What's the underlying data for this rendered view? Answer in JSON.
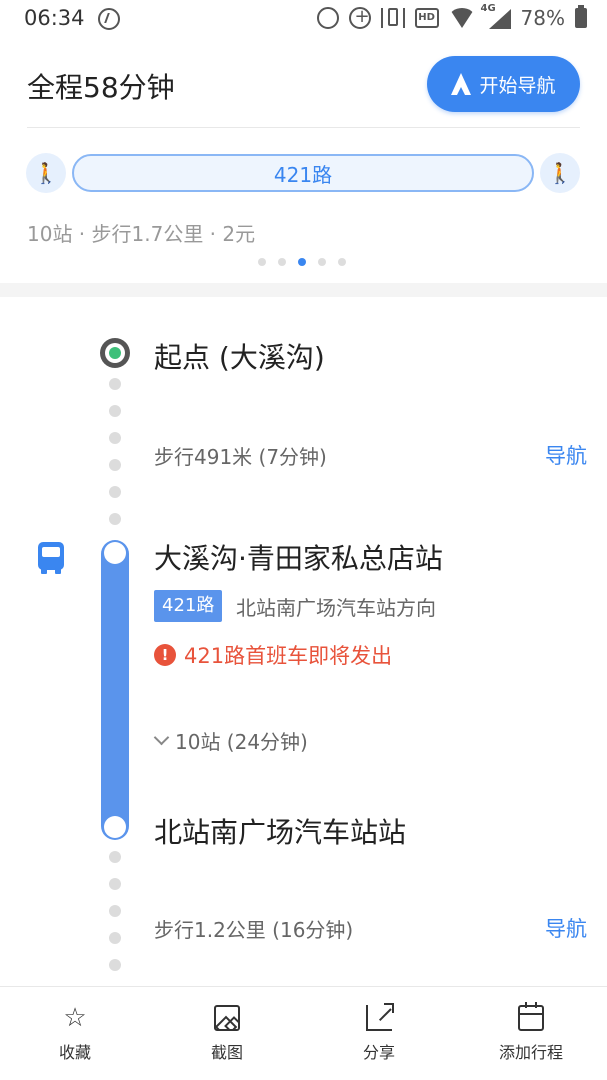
{
  "status_bar": {
    "time": "06:34",
    "network": "4G",
    "hd": "HD",
    "battery": "78%"
  },
  "header": {
    "total_time": "全程58分钟",
    "start_nav_label": "开始导航"
  },
  "route_summary": {
    "line": "421路",
    "meta": "10站 · 步行1.7公里 · 2元",
    "page_count": 5,
    "active_page": 3
  },
  "timeline": {
    "origin": "起点 (大溪沟)",
    "walk1": "步行491米 (7分钟)",
    "walk1_nav": "导航",
    "board_stop": "大溪沟·青田家私总店站",
    "route_tag": "421路",
    "direction": "北站南广场汽车站方向",
    "alert": "421路首班车即将发出",
    "stops": "10站 (24分钟)",
    "alight_stop": "北站南广场汽车站站",
    "walk2": "步行1.2公里 (16分钟)",
    "walk2_nav": "导航"
  },
  "bottom_bar": {
    "favorite": "收藏",
    "screenshot": "截图",
    "share": "分享",
    "add_trip": "添加行程"
  },
  "colors": {
    "accent": "#3a86f0",
    "alert": "#e8533b",
    "origin_dot": "#3ec07a"
  }
}
